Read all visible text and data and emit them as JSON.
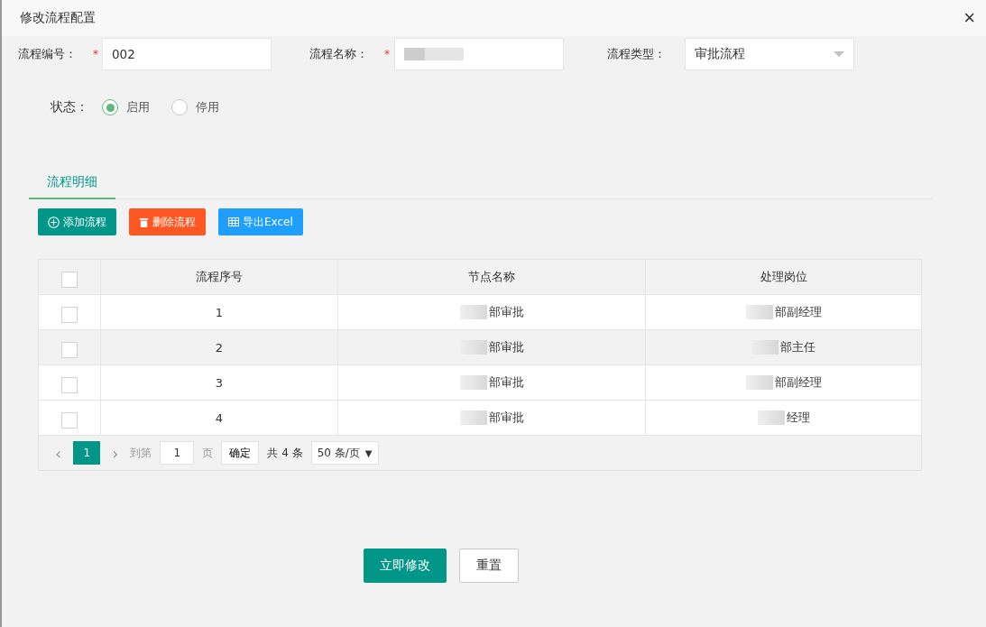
{
  "window": {
    "title": "修改流程配置",
    "close": "×"
  },
  "form": {
    "fields": [
      {
        "label": "流程编号：",
        "required_mark": "*",
        "kind": "input",
        "value": "002"
      },
      {
        "label": "流程名称：",
        "required_mark": "*",
        "kind": "input",
        "blurred": true
      },
      {
        "label": "流程类型：",
        "kind": "select",
        "value": "审批流程"
      }
    ],
    "status": {
      "label": "状态：",
      "options": [
        {
          "label": "启用",
          "selected": true
        },
        {
          "label": "停用",
          "selected": false
        }
      ]
    }
  },
  "tabs": [
    {
      "label": "流程明细",
      "selected": true
    }
  ],
  "toolbar": [
    {
      "label": "添加流程",
      "kind": "add"
    },
    {
      "label": "删除流程",
      "kind": "delete"
    },
    {
      "label": "导出Excel",
      "kind": "export"
    }
  ],
  "table": {
    "all_checked": false,
    "columns": [
      "流程序号",
      "节点名称",
      "处理岗位"
    ],
    "rows": [
      {
        "checked": false,
        "highlighted": false,
        "cells": [
          "1",
          "部审批",
          "部副经理"
        ]
      },
      {
        "checked": false,
        "highlighted": true,
        "cells": [
          "2",
          "部审批",
          "部主任"
        ]
      },
      {
        "checked": false,
        "highlighted": false,
        "cells": [
          "3",
          "部审批",
          "部副经理"
        ]
      },
      {
        "checked": false,
        "highlighted": false,
        "cells": [
          "4",
          "部审批",
          "经理"
        ]
      }
    ]
  },
  "pager": {
    "prev": "‹",
    "pages": [
      {
        "label": "1",
        "selected": true
      }
    ],
    "next": "›",
    "goto": "到第",
    "page_value": "1",
    "page_unit": "页",
    "confirm": "确定",
    "total": "共 4 条",
    "size": "50 条/页",
    "size_caret": "▼"
  },
  "actions": [
    {
      "label": "立即修改",
      "kind": "primary"
    },
    {
      "label": "重置",
      "kind": "secondary"
    }
  ]
}
